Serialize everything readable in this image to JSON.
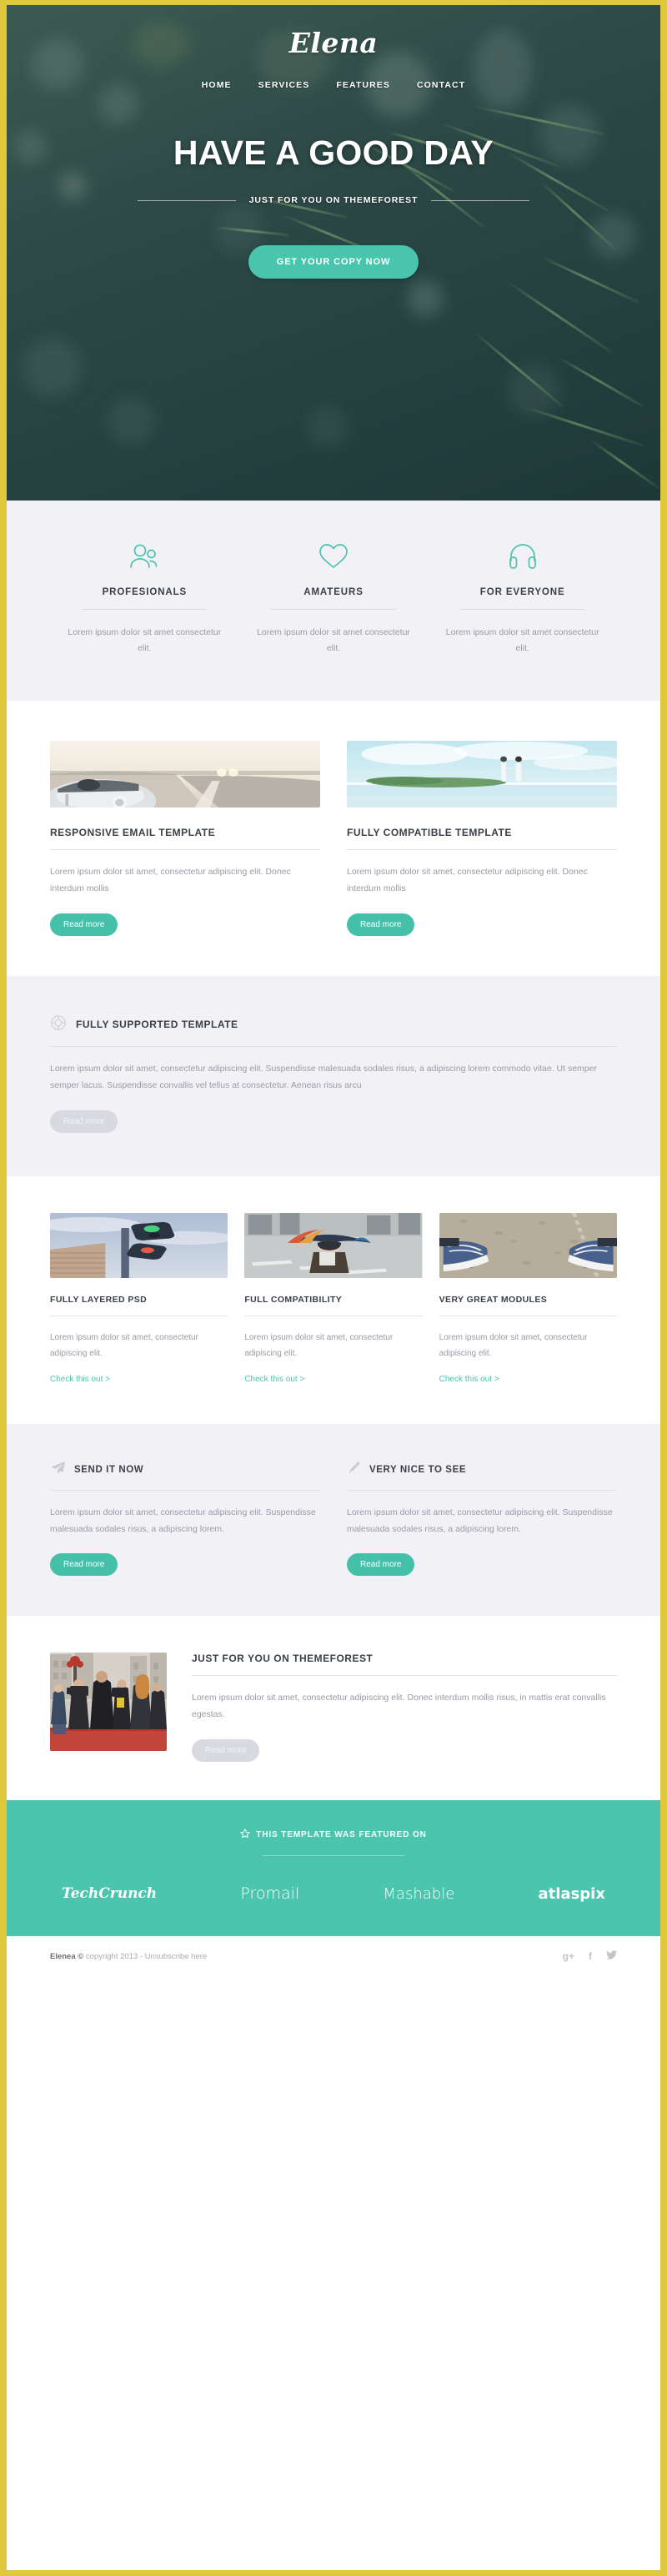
{
  "hero": {
    "brand": "Elena",
    "nav": [
      {
        "label": "HOME"
      },
      {
        "label": "SERVICES"
      },
      {
        "label": "FEATURES"
      },
      {
        "label": "CONTACT"
      }
    ],
    "title": "HAVE A GOOD DAY",
    "subtitle": "JUST FOR YOU ON THEMEFOREST",
    "cta_label": "GET YOUR COPY NOW"
  },
  "features": {
    "items": [
      {
        "icon": "users-icon",
        "title": "PROFESIONALS",
        "body": "Lorem ipsum dolor sit amet consectetur elit."
      },
      {
        "icon": "heart-icon",
        "title": "AMATEURS",
        "body": "Lorem ipsum dolor sit amet consectetur elit."
      },
      {
        "icon": "headphones-icon",
        "title": "FOR EVERYONE",
        "body": "Lorem ipsum dolor sit amet consectetur elit."
      }
    ]
  },
  "cards_two": {
    "items": [
      {
        "image": "classic-car-on-road-photo",
        "title": "RESPONSIVE EMAIL TEMPLATE",
        "body": "Lorem ipsum dolor sit amet, consectetur adipiscing elit. Donec interdum mollis",
        "button": "Read more"
      },
      {
        "image": "couple-on-beach-photo",
        "title": "FULLY COMPATIBLE TEMPLATE",
        "body": "Lorem ipsum dolor sit amet, consectetur adipiscing elit. Donec interdum mollis",
        "button": "Read more"
      }
    ]
  },
  "band_supported": {
    "icon": "lifebuoy-icon",
    "title": "FULLY SUPPORTED TEMPLATE",
    "body": "Lorem ipsum dolor sit amet, consectetur adipiscing elit. Suspendisse malesuada sodales risus, a adipiscing lorem commodo vitae. Ut semper semper lacus. Suspendisse convallis vel tellus at consectetur. Aenean risus arcu",
    "button": "Read more"
  },
  "cards_three": {
    "items": [
      {
        "image": "traffic-light-photo",
        "title": "FULLY LAYERED PSD",
        "body": "Lorem ipsum dolor sit amet, consectetur adipiscing elit.",
        "link": "Check this out  >"
      },
      {
        "image": "woman-with-umbrella-photo",
        "title": "FULL COMPATIBILITY",
        "body": "Lorem ipsum dolor sit amet, consectetur adipiscing elit.",
        "link": "Check this out  >"
      },
      {
        "image": "sneakers-on-pavement-photo",
        "title": "VERY GREAT MODULES",
        "body": "Lorem ipsum dolor sit amet, consectetur adipiscing elit.",
        "link": "Check this out  >"
      }
    ]
  },
  "icon_two": {
    "items": [
      {
        "icon": "paper-plane-icon",
        "title": "SEND IT NOW",
        "body": "Lorem ipsum dolor sit amet, consectetur adipiscing elit. Suspendisse malesuada sodales risus, a adipiscing lorem.",
        "button": "Read more"
      },
      {
        "icon": "pencil-icon",
        "title": "VERY NICE TO SEE",
        "body": "Lorem ipsum dolor sit amet, consectetur adipiscing elit. Suspendisse malesuada sodales risus, a adipiscing lorem.",
        "button": "Read more"
      }
    ]
  },
  "wide_section": {
    "image": "red-carpet-photographers-photo",
    "title": "JUST FOR YOU ON THEMEFOREST",
    "body": "Lorem ipsum dolor sit amet, consectetur adipiscing elit. Donec interdum mollis risus, in mattis erat convallis egestas.",
    "button": "Read more"
  },
  "featured": {
    "icon": "star-icon",
    "heading": "THIS TEMPLATE WAS FEATURED ON",
    "logos": [
      {
        "name": "TechCrunch"
      },
      {
        "name": "Promail"
      },
      {
        "name": "Mashable"
      },
      {
        "name": "atlaspix"
      }
    ]
  },
  "footer": {
    "brand": "Elenea ©",
    "copyright": " copyright 2013 - Unsubscribe here",
    "social": [
      {
        "icon": "google-plus-icon",
        "glyph": "g+"
      },
      {
        "icon": "facebook-icon",
        "glyph": "f"
      },
      {
        "icon": "twitter-icon",
        "glyph": "ᵛ"
      }
    ]
  },
  "colors": {
    "accent_teal": "#4cc5ae",
    "border_yellow": "#e0c93c",
    "heading": "#3a3f47",
    "body_text": "#9a9aa4"
  }
}
